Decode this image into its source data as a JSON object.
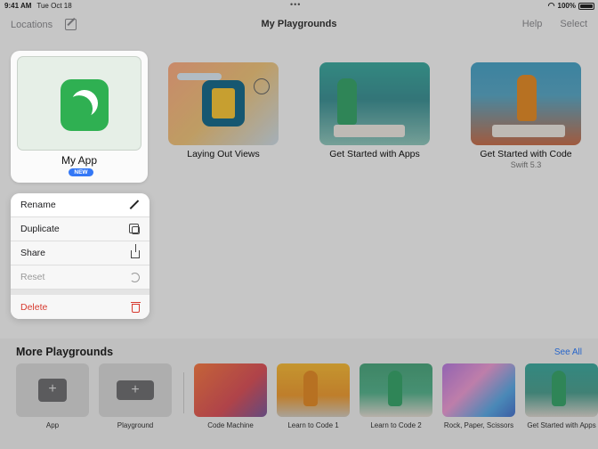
{
  "status": {
    "time": "9:41 AM",
    "date": "Tue Oct 18",
    "battery": "100%",
    "dots": "•••"
  },
  "nav": {
    "locations": "Locations",
    "title": "My Playgrounds",
    "help": "Help",
    "select": "Select"
  },
  "playgrounds": [
    {
      "title": "My App",
      "badge": "NEW"
    },
    {
      "title": "Laying Out Views",
      "subtitle": ""
    },
    {
      "title": "Get Started with Apps",
      "subtitle": ""
    },
    {
      "title": "Get Started with Code",
      "subtitle": "Swift 5.3"
    }
  ],
  "menu": {
    "rename": "Rename",
    "duplicate": "Duplicate",
    "share": "Share",
    "reset": "Reset",
    "delete": "Delete"
  },
  "more": {
    "title": "More Playgrounds",
    "see_all": "See All",
    "tiles": [
      {
        "label": "App",
        "plus": "+"
      },
      {
        "label": "Playground",
        "plus": "+"
      },
      {
        "label": "Code Machine"
      },
      {
        "label": "Learn to Code 1"
      },
      {
        "label": "Learn to Code 2"
      },
      {
        "label": "Rock, Paper, Scissors"
      },
      {
        "label": "Get Started with Apps"
      }
    ]
  },
  "colors": {
    "accent": "#3478f6",
    "destructive": "#d73a2f",
    "app_icon": "#2fb052"
  }
}
